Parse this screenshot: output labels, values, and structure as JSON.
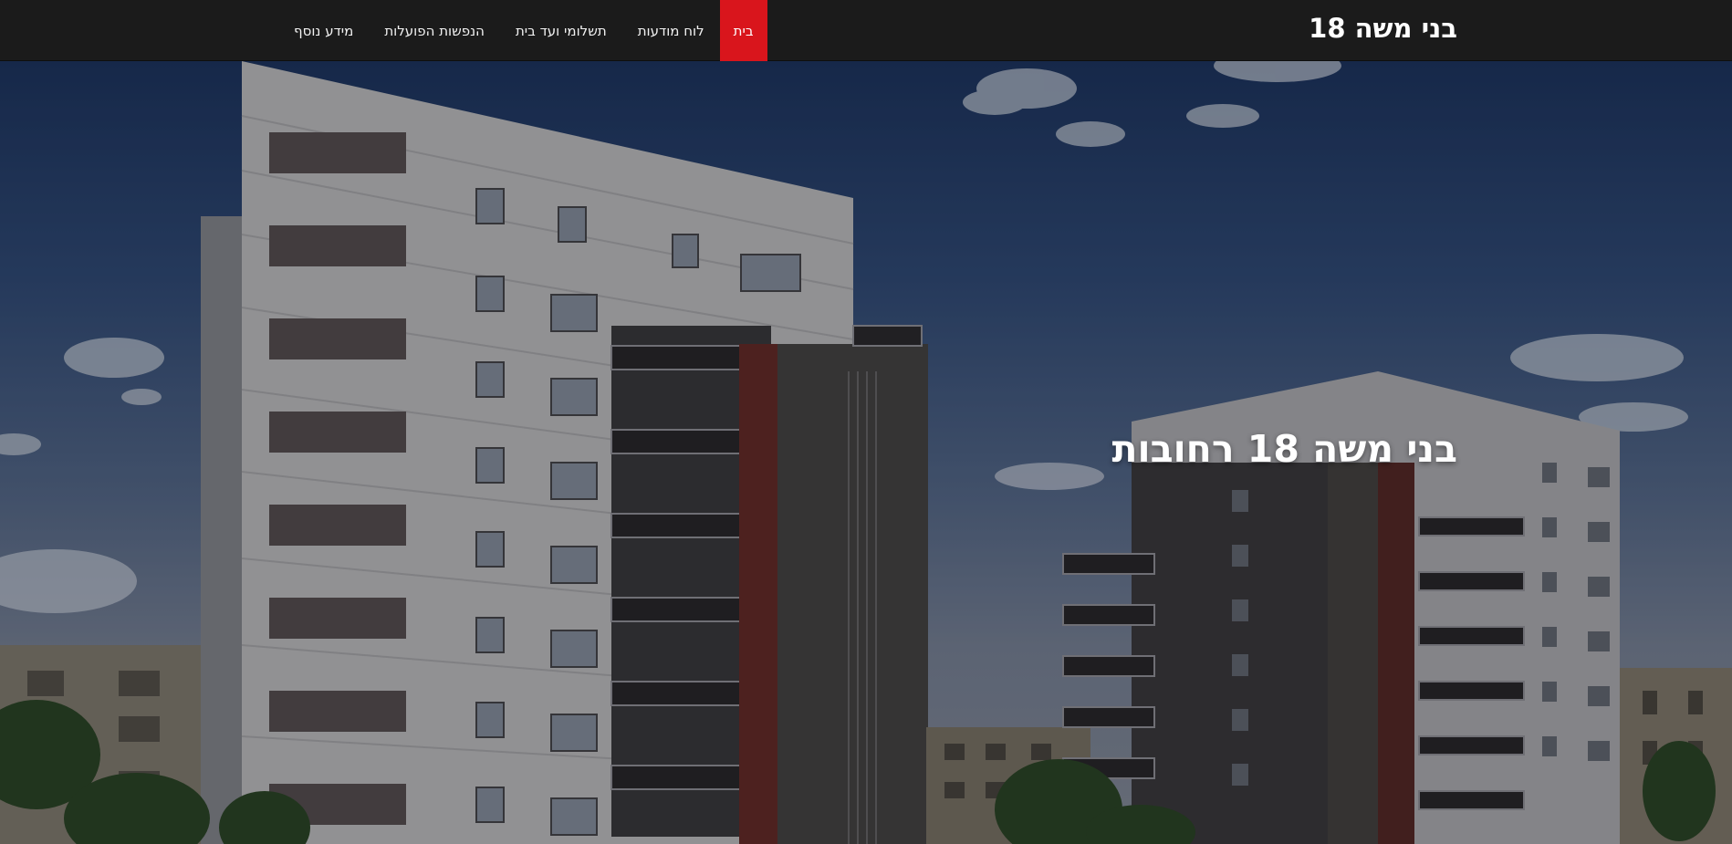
{
  "navbar": {
    "brand": "בני משה 18",
    "items": [
      {
        "label": "בית",
        "active": true
      },
      {
        "label": "לוח מודעות",
        "active": false
      },
      {
        "label": "תשלומי ועד בית",
        "active": false
      },
      {
        "label": "הנפשות הפועלות",
        "active": false
      },
      {
        "label": "מידע נוסף",
        "active": false
      }
    ]
  },
  "hero": {
    "title": "בני משה 18 רחובות"
  },
  "colors": {
    "navbar_bg": "#1b1b1b",
    "active_tab": "#d9151c",
    "text": "#ffffff"
  }
}
